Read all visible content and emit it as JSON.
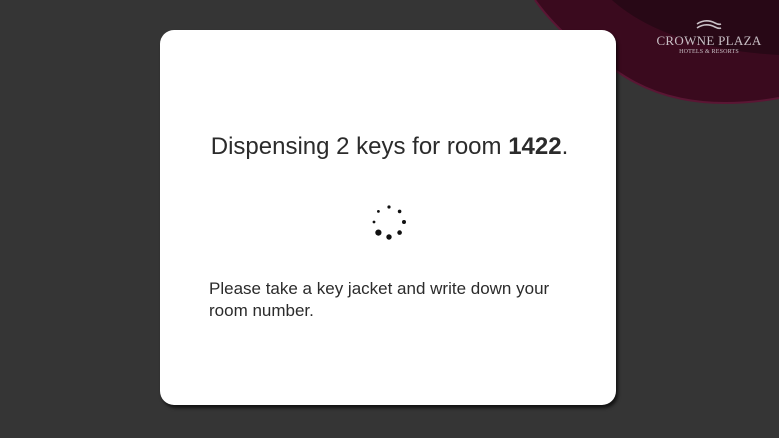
{
  "brand": {
    "name": "CROWNE PLAZA",
    "tagline": "HOTELS & RESORTS",
    "logo_icon": "crown-wave-icon",
    "accent_color": "#3a0a1e"
  },
  "dialog": {
    "message_prefix": "Dispensing 2 keys for room ",
    "room_number": "1422",
    "message_suffix": ".",
    "spinner_icon": "loading-spinner-icon",
    "instructions": "Please take a key jacket and write down your room number."
  }
}
